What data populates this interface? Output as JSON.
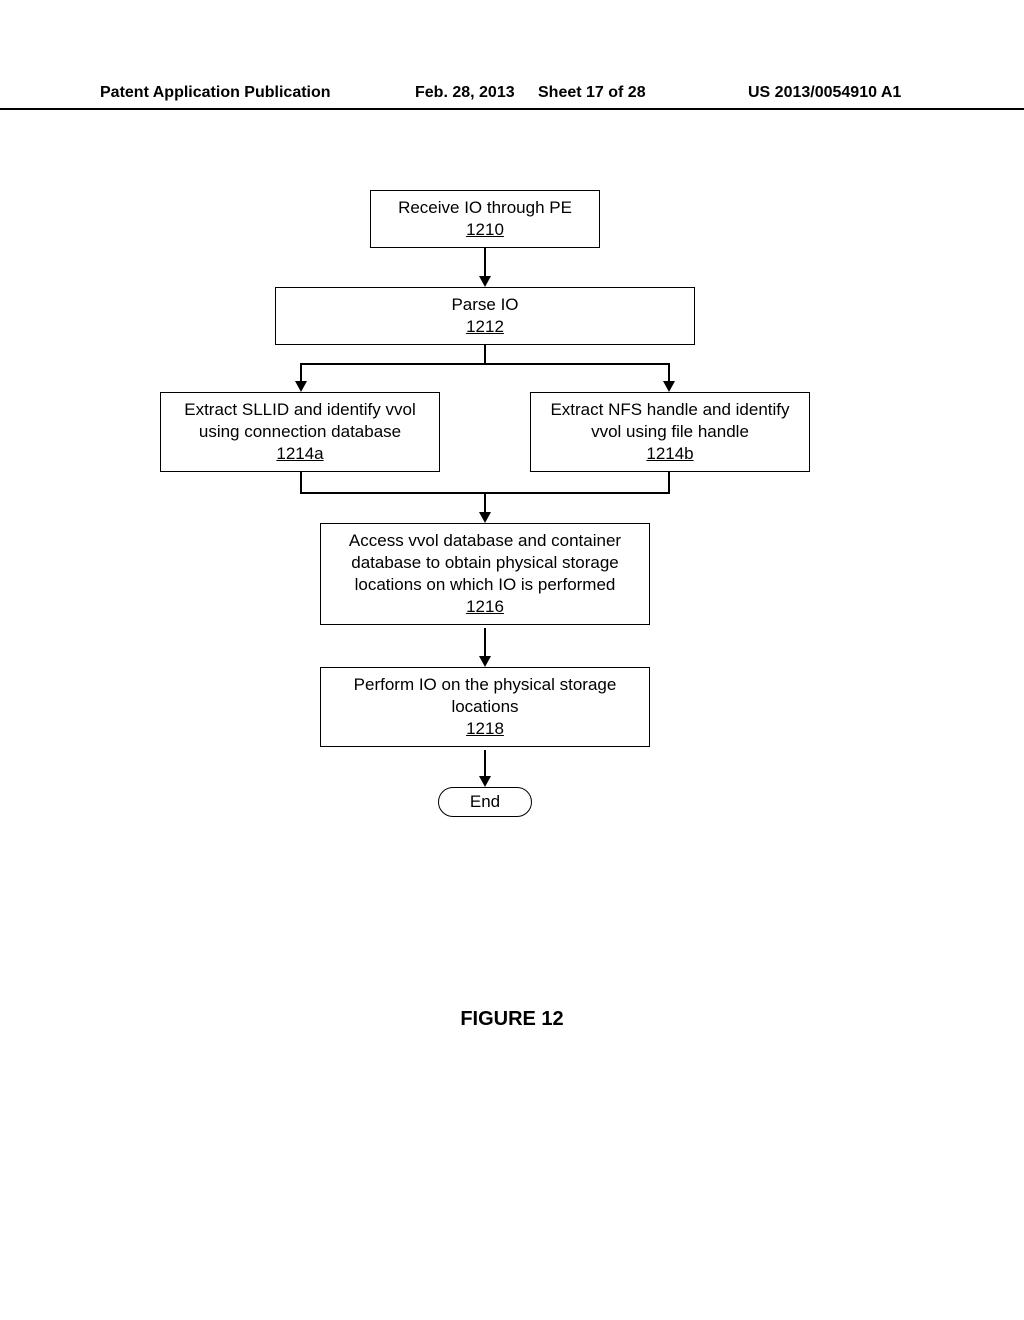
{
  "header": {
    "publication_label": "Patent Application Publication",
    "date": "Feb. 28, 2013",
    "sheet": "Sheet 17 of 28",
    "patent_number": "US 2013/0054910 A1"
  },
  "nodes": {
    "n1210": {
      "text": "Receive IO through PE",
      "ref": "1210"
    },
    "n1212": {
      "text": "Parse IO",
      "ref": "1212"
    },
    "n1214a": {
      "text": "Extract SLLID and identify vvol using connection database",
      "ref": "1214a"
    },
    "n1214b": {
      "text": "Extract NFS handle and identify vvol using file handle",
      "ref": "1214b"
    },
    "n1216": {
      "text": "Access vvol database and container database to obtain physical storage locations on which IO is performed",
      "ref": "1216"
    },
    "n1218": {
      "text": "Perform IO on the physical storage locations",
      "ref": "1218"
    },
    "end": {
      "text": "End"
    }
  },
  "figure_label": "FIGURE 12"
}
